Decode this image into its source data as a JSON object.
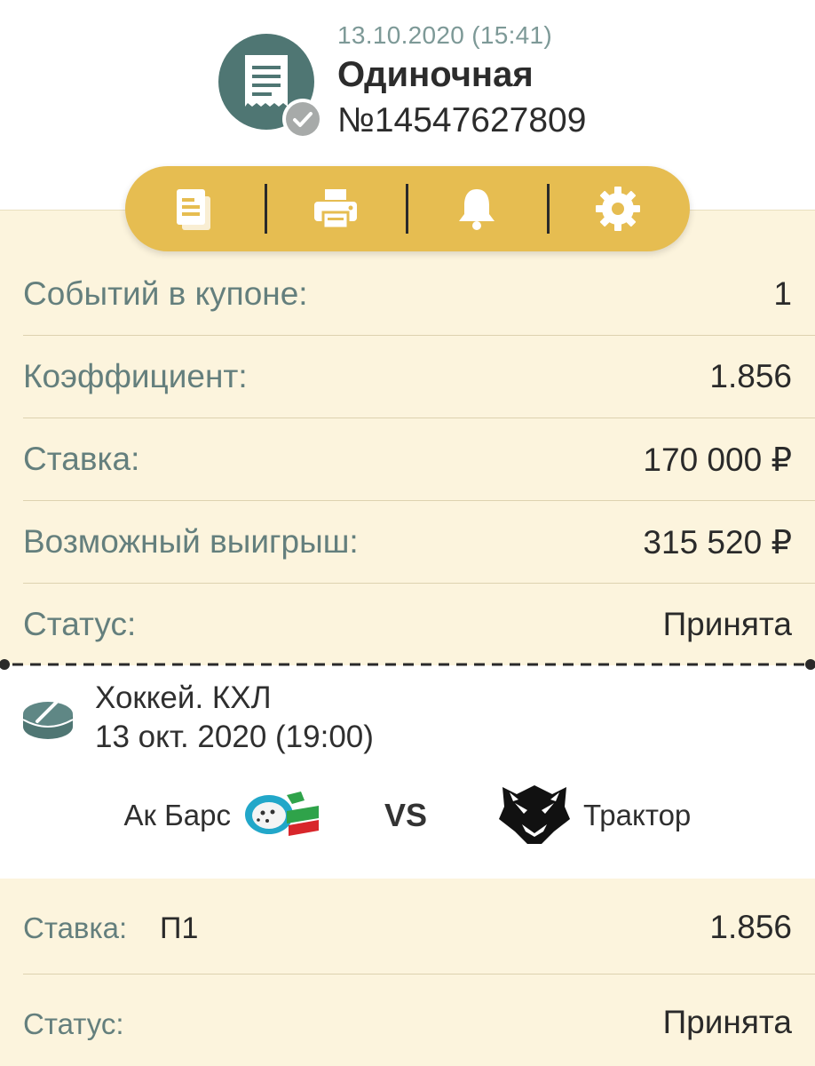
{
  "header": {
    "date_time": "13.10.2020 (15:41)",
    "title": "Одиночная",
    "coupon_number": "№14547627809",
    "icon": "receipt-icon",
    "badge_icon": "check-icon",
    "avatar_color": "#4f7673"
  },
  "toolbar": {
    "color": "#e6bd51",
    "buttons": [
      {
        "icon": "copy-document-icon"
      },
      {
        "icon": "printer-icon"
      },
      {
        "icon": "bell-icon"
      },
      {
        "icon": "gear-icon"
      }
    ]
  },
  "summary": {
    "rows": [
      {
        "label": "Событий в купоне:",
        "value": "1"
      },
      {
        "label": "Коэффициент:",
        "value": "1.856"
      },
      {
        "label": "Ставка:",
        "value": "170 000 ₽"
      },
      {
        "label": "Возможный выигрыш:",
        "value": "315 520 ₽"
      },
      {
        "label": "Статус:",
        "value": "Принята"
      }
    ]
  },
  "event": {
    "sport_league": "Хоккей. КХЛ",
    "datetime": "13 окт. 2020 (19:00)",
    "sport_icon": "hockey-puck-icon",
    "team1": {
      "name": "Ак Барс",
      "logo": "ak-bars-logo"
    },
    "vs": "VS",
    "team2": {
      "name": "Трактор",
      "logo": "traktor-logo"
    }
  },
  "bet": {
    "stake_label": "Ставка:",
    "outcome": "П1",
    "odds": "1.856",
    "status_label": "Статус:",
    "status": "Принята"
  },
  "colors": {
    "panel": "#fcf4dd",
    "label_text": "#647f7d",
    "accent": "#e6bd51"
  }
}
